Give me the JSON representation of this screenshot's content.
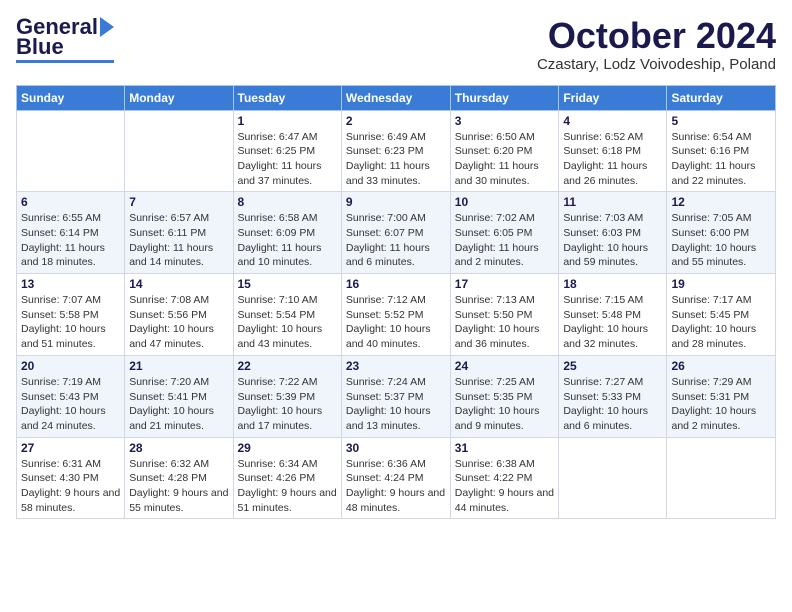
{
  "header": {
    "logo_general": "General",
    "logo_blue": "Blue",
    "month_title": "October 2024",
    "subtitle": "Czastary, Lodz Voivodeship, Poland"
  },
  "weekdays": [
    "Sunday",
    "Monday",
    "Tuesday",
    "Wednesday",
    "Thursday",
    "Friday",
    "Saturday"
  ],
  "weeks": [
    [
      {
        "day": "",
        "info": ""
      },
      {
        "day": "",
        "info": ""
      },
      {
        "day": "1",
        "info": "Sunrise: 6:47 AM\nSunset: 6:25 PM\nDaylight: 11 hours and 37 minutes."
      },
      {
        "day": "2",
        "info": "Sunrise: 6:49 AM\nSunset: 6:23 PM\nDaylight: 11 hours and 33 minutes."
      },
      {
        "day": "3",
        "info": "Sunrise: 6:50 AM\nSunset: 6:20 PM\nDaylight: 11 hours and 30 minutes."
      },
      {
        "day": "4",
        "info": "Sunrise: 6:52 AM\nSunset: 6:18 PM\nDaylight: 11 hours and 26 minutes."
      },
      {
        "day": "5",
        "info": "Sunrise: 6:54 AM\nSunset: 6:16 PM\nDaylight: 11 hours and 22 minutes."
      }
    ],
    [
      {
        "day": "6",
        "info": "Sunrise: 6:55 AM\nSunset: 6:14 PM\nDaylight: 11 hours and 18 minutes."
      },
      {
        "day": "7",
        "info": "Sunrise: 6:57 AM\nSunset: 6:11 PM\nDaylight: 11 hours and 14 minutes."
      },
      {
        "day": "8",
        "info": "Sunrise: 6:58 AM\nSunset: 6:09 PM\nDaylight: 11 hours and 10 minutes."
      },
      {
        "day": "9",
        "info": "Sunrise: 7:00 AM\nSunset: 6:07 PM\nDaylight: 11 hours and 6 minutes."
      },
      {
        "day": "10",
        "info": "Sunrise: 7:02 AM\nSunset: 6:05 PM\nDaylight: 11 hours and 2 minutes."
      },
      {
        "day": "11",
        "info": "Sunrise: 7:03 AM\nSunset: 6:03 PM\nDaylight: 10 hours and 59 minutes."
      },
      {
        "day": "12",
        "info": "Sunrise: 7:05 AM\nSunset: 6:00 PM\nDaylight: 10 hours and 55 minutes."
      }
    ],
    [
      {
        "day": "13",
        "info": "Sunrise: 7:07 AM\nSunset: 5:58 PM\nDaylight: 10 hours and 51 minutes."
      },
      {
        "day": "14",
        "info": "Sunrise: 7:08 AM\nSunset: 5:56 PM\nDaylight: 10 hours and 47 minutes."
      },
      {
        "day": "15",
        "info": "Sunrise: 7:10 AM\nSunset: 5:54 PM\nDaylight: 10 hours and 43 minutes."
      },
      {
        "day": "16",
        "info": "Sunrise: 7:12 AM\nSunset: 5:52 PM\nDaylight: 10 hours and 40 minutes."
      },
      {
        "day": "17",
        "info": "Sunrise: 7:13 AM\nSunset: 5:50 PM\nDaylight: 10 hours and 36 minutes."
      },
      {
        "day": "18",
        "info": "Sunrise: 7:15 AM\nSunset: 5:48 PM\nDaylight: 10 hours and 32 minutes."
      },
      {
        "day": "19",
        "info": "Sunrise: 7:17 AM\nSunset: 5:45 PM\nDaylight: 10 hours and 28 minutes."
      }
    ],
    [
      {
        "day": "20",
        "info": "Sunrise: 7:19 AM\nSunset: 5:43 PM\nDaylight: 10 hours and 24 minutes."
      },
      {
        "day": "21",
        "info": "Sunrise: 7:20 AM\nSunset: 5:41 PM\nDaylight: 10 hours and 21 minutes."
      },
      {
        "day": "22",
        "info": "Sunrise: 7:22 AM\nSunset: 5:39 PM\nDaylight: 10 hours and 17 minutes."
      },
      {
        "day": "23",
        "info": "Sunrise: 7:24 AM\nSunset: 5:37 PM\nDaylight: 10 hours and 13 minutes."
      },
      {
        "day": "24",
        "info": "Sunrise: 7:25 AM\nSunset: 5:35 PM\nDaylight: 10 hours and 9 minutes."
      },
      {
        "day": "25",
        "info": "Sunrise: 7:27 AM\nSunset: 5:33 PM\nDaylight: 10 hours and 6 minutes."
      },
      {
        "day": "26",
        "info": "Sunrise: 7:29 AM\nSunset: 5:31 PM\nDaylight: 10 hours and 2 minutes."
      }
    ],
    [
      {
        "day": "27",
        "info": "Sunrise: 6:31 AM\nSunset: 4:30 PM\nDaylight: 9 hours and 58 minutes."
      },
      {
        "day": "28",
        "info": "Sunrise: 6:32 AM\nSunset: 4:28 PM\nDaylight: 9 hours and 55 minutes."
      },
      {
        "day": "29",
        "info": "Sunrise: 6:34 AM\nSunset: 4:26 PM\nDaylight: 9 hours and 51 minutes."
      },
      {
        "day": "30",
        "info": "Sunrise: 6:36 AM\nSunset: 4:24 PM\nDaylight: 9 hours and 48 minutes."
      },
      {
        "day": "31",
        "info": "Sunrise: 6:38 AM\nSunset: 4:22 PM\nDaylight: 9 hours and 44 minutes."
      },
      {
        "day": "",
        "info": ""
      },
      {
        "day": "",
        "info": ""
      }
    ]
  ]
}
